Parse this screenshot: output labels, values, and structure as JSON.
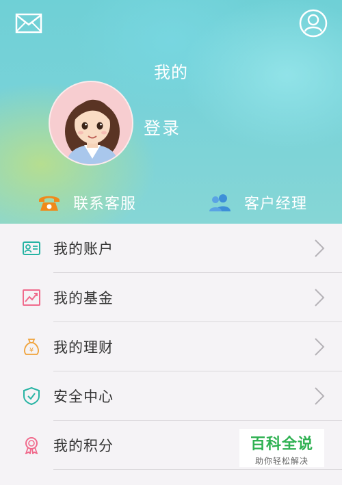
{
  "header": {
    "title": "我的",
    "login_label": "登录",
    "mail_icon": "mail-icon",
    "user_icon": "user-circle-icon"
  },
  "quick_links": {
    "service_label": "联系客服",
    "manager_label": "客户经理"
  },
  "menu": {
    "items": [
      {
        "label": "我的账户",
        "icon": "id-card-icon",
        "color": "#26b3a3"
      },
      {
        "label": "我的基金",
        "icon": "chart-icon",
        "color": "#f06a8c"
      },
      {
        "label": "我的理财",
        "icon": "money-bag-icon",
        "color": "#f0a23a"
      },
      {
        "label": "安全中心",
        "icon": "shield-icon",
        "color": "#26b3a3"
      },
      {
        "label": "我的积分",
        "icon": "medal-icon",
        "color": "#f06a8c"
      }
    ]
  },
  "watermark": {
    "title": "百科全说",
    "subtitle": "助你轻松解决"
  },
  "colors": {
    "header_bg": "#78d2d8",
    "phone_icon": "#f08a1a",
    "manager_icon": "#3d8fd8"
  }
}
